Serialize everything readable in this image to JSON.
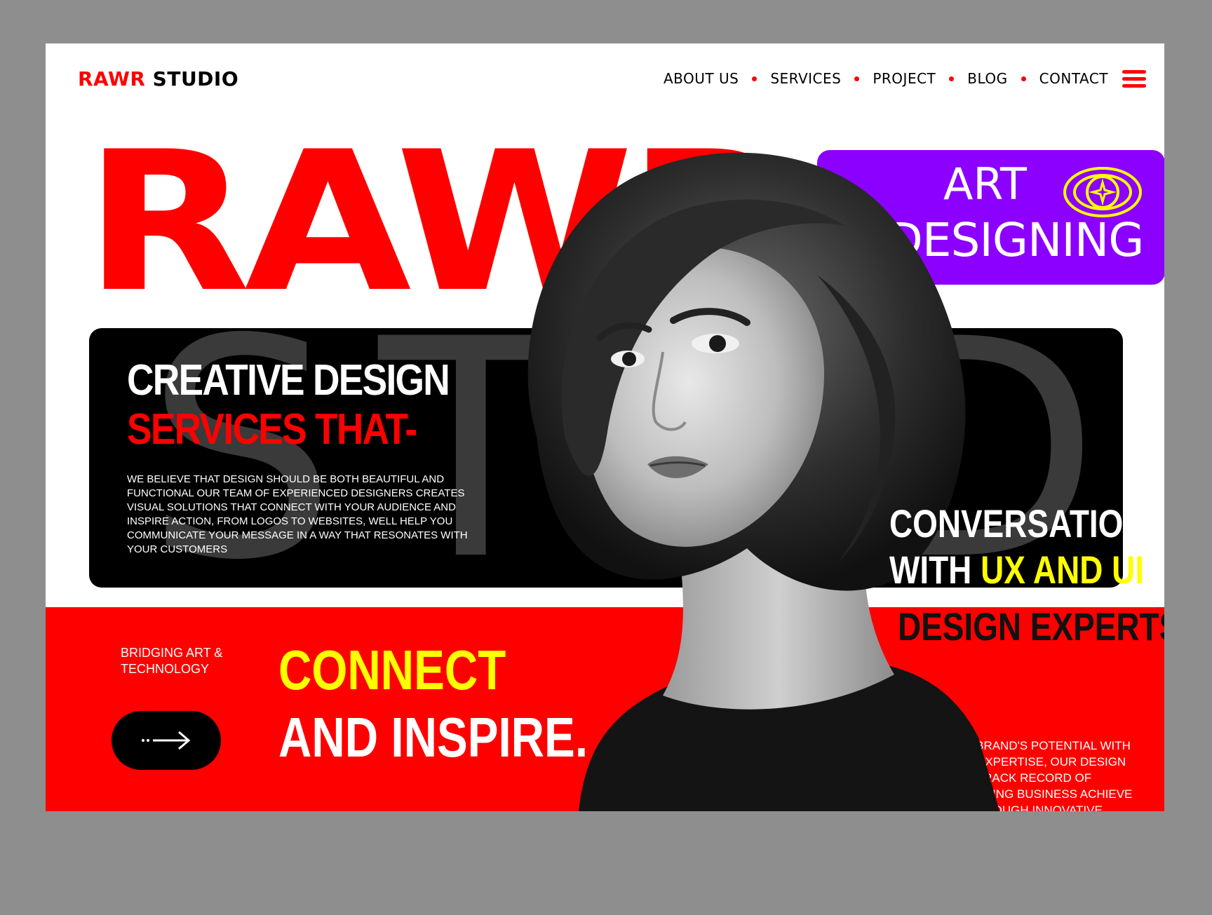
{
  "header": {
    "logo_red": "RAWR",
    "logo_black": "STUDIO",
    "nav": [
      "ABOUT US",
      "SERVICES",
      "PROJECT",
      "BLOG",
      "CONTACT"
    ],
    "menu_icon": "hamburger-menu-icon"
  },
  "hero": {
    "big_word": "RAWR",
    "art_box": {
      "line1": "ART",
      "line2": "DESIGNING",
      "icon": "eye-star-icon"
    }
  },
  "panel": {
    "ghost_text": "STUDIO",
    "headline_white": "CREATIVE DESIGN",
    "headline_red": "SERVICES THAT-",
    "body": "WE BELIEVE THAT DESIGN SHOULD BE BOTH BEAUTIFUL AND FUNCTIONAL OUR TEAM OF EXPERIENCED DESIGNERS CREATES VISUAL SOLUTIONS THAT CONNECT WITH YOUR AUDIENCE AND INSPIRE ACTION, FROM LOGOS TO WEBSITES, WELL HELP YOU COMMUNICATE YOUR MESSAGE IN A WAY THAT RESONATES WITH YOUR CUSTOMERS"
  },
  "side_text": {
    "line1": "CONVERSATIONS",
    "line2_white": "WITH ",
    "line2_yellow": "UX AND UI",
    "line3": "DESIGN EXPERTS"
  },
  "band": {
    "bridging": "BRIDGING ART & TECHNOLOGY",
    "cta_icon": "arrow-right-icon",
    "connect": "CONNECT",
    "inspire": "AND INSPIRE.",
    "unlock": "UNLOCK YOUR BRAND'S POTENTIAL WITH  OUR CREATIVE EXPERTISE, OUR DESIGN AGENCY HAS A TRACK RECORD OF SUCCESS IN HELPING BUSINESS ACHIEVE THEIR GOALS THROUGH INNOVATIVE DESIGN SOLUTIONS"
  },
  "colors": {
    "red": "#ff0000",
    "purple": "#8b00ff",
    "yellow": "#ffff00",
    "black": "#000000",
    "backdrop": "#8e8e8e"
  }
}
